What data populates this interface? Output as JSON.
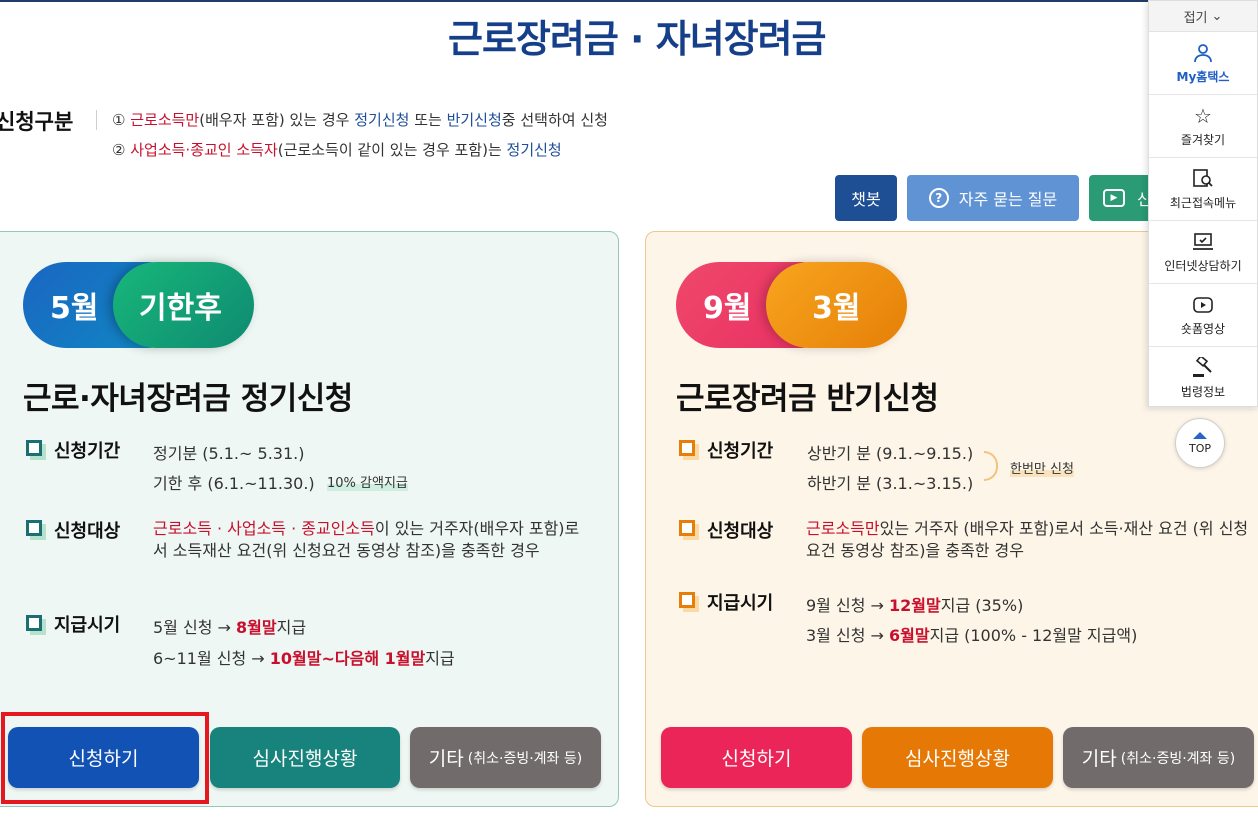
{
  "page": {
    "title": "근로장려금 · 자녀장려금"
  },
  "category": {
    "label": "신청구분",
    "line1": {
      "num": "①",
      "red": "근로소득만",
      "text1": "(배우자 포함) 있는 경우 ",
      "blue1": "정기신청",
      "text2": " 또는 ",
      "blue2": "반기신청",
      "text3": "중 선택하여 신청"
    },
    "line2": {
      "num": "②",
      "red": "사업소득·종교인 소득자",
      "text1": "(근로소득이 같이 있는 경우 포함)는 ",
      "blue1": "정기신청"
    }
  },
  "top_buttons": {
    "chatbot": "챗봇",
    "faq": "자주 묻는 질문",
    "video": "신"
  },
  "left_panel": {
    "pill_month": "5월",
    "pill_after": "기한후",
    "heading": "근로·자녀장려금 정기신청",
    "period_label": "신청기간",
    "period_line1": "정기분 (5.1.~ 5.31.)",
    "period_line2": "기한 후 (6.1.~11.30.)",
    "period_note": "10% 감액지급",
    "target_label": "신청대상",
    "target_red": "근로소득 · 사업소득 · 종교인소득",
    "target_text": "이 있는 거주자(배우자 포함)로서 소득재산 요건(위 신청요건 동영상 참조)을 충족한 경우",
    "pay_label": "지급시기",
    "pay1_a": "5월 신청 → ",
    "pay1_b": "8월말",
    "pay1_c": "지급",
    "pay2_a": "6~11월 신청 → ",
    "pay2_b": "10월말~다음해 1월말",
    "pay2_c": "지급",
    "btn_apply": "신청하기",
    "btn_status": "심사진행상황",
    "btn_etc": "기타",
    "btn_etc_sub": "(취소·증빙·계좌 등)"
  },
  "right_panel": {
    "pill_sep": "9월",
    "pill_mar": "3월",
    "heading": "근로장려금 반기신청",
    "period_label": "신청기간",
    "period_line1": "상반기 분 (9.1.~9.15.)",
    "period_line2": "하반기 분 (3.1.~3.15.)",
    "period_note": "한번만 신청",
    "target_label": "신청대상",
    "target_red": "근로소득만",
    "target_text": "있는 거주자 (배우자 포함)로서 소득·재산 요건 (위 신청요건 동영상 참조)을 충족한 경우",
    "pay_label": "지급시기",
    "pay1_a": "9월 신청 → ",
    "pay1_b": "12월말",
    "pay1_c": "지급 (35%)",
    "pay2_a": "3월 신청 → ",
    "pay2_b": "6월말",
    "pay2_c": "지급 (100% - 12월말 지급액)",
    "btn_apply": "신청하기",
    "btn_status": "심사진행상황",
    "btn_etc": "기타",
    "btn_etc_sub": "(취소·증빙·계좌 등)"
  },
  "quick_menu": {
    "fold": "접기",
    "items": [
      {
        "label": "My홈택스",
        "icon": "user-icon"
      },
      {
        "label": "즐겨찾기",
        "icon": "star-icon"
      },
      {
        "label": "최근접속메뉴",
        "icon": "recent-doc-icon"
      },
      {
        "label": "인터넷상담하기",
        "icon": "monitor-check-icon"
      },
      {
        "label": "숏폼영상",
        "icon": "play-icon"
      },
      {
        "label": "법령정보",
        "icon": "gavel-icon"
      }
    ],
    "top": "TOP"
  },
  "colors": {
    "title_blue": "#163f8a",
    "highlight_red": "#e4181e",
    "left_panel_bg": "#eef7f3",
    "right_panel_bg": "#fdf5e8"
  }
}
